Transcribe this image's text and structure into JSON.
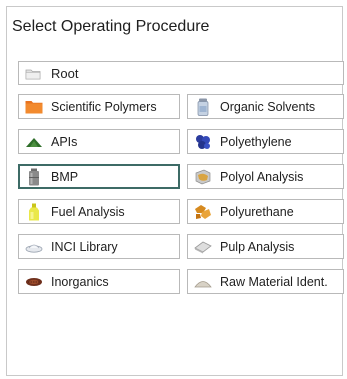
{
  "title": "Select Operating Procedure",
  "root": {
    "label": "Root",
    "icon": "folder-gray-icon"
  },
  "procedures": [
    {
      "label": "Scientific Polymers",
      "icon": "orange-folder-icon",
      "selected": false
    },
    {
      "label": "Organic Solvents",
      "icon": "solvent-bottle-icon",
      "selected": false
    },
    {
      "label": "APIs",
      "icon": "green-powder-icon",
      "selected": false
    },
    {
      "label": "Polyethylene",
      "icon": "blue-granules-icon",
      "selected": false
    },
    {
      "label": "BMP",
      "icon": "gray-canister-icon",
      "selected": true
    },
    {
      "label": "Polyol Analysis",
      "icon": "polyol-sample-icon",
      "selected": false
    },
    {
      "label": "Fuel Analysis",
      "icon": "yellow-bottle-icon",
      "selected": false
    },
    {
      "label": "Polyurethane",
      "icon": "foam-pieces-icon",
      "selected": false
    },
    {
      "label": "INCI Library",
      "icon": "cosmetic-dish-icon",
      "selected": false
    },
    {
      "label": "Pulp Analysis",
      "icon": "pulp-sheet-icon",
      "selected": false
    },
    {
      "label": "Inorganics",
      "icon": "brown-pellet-icon",
      "selected": false
    },
    {
      "label": "Raw Material Ident.",
      "icon": "powder-pile-icon",
      "selected": false
    }
  ],
  "colors": {
    "selected_border": "#3d6b66",
    "button_border": "#b9b9b9"
  }
}
